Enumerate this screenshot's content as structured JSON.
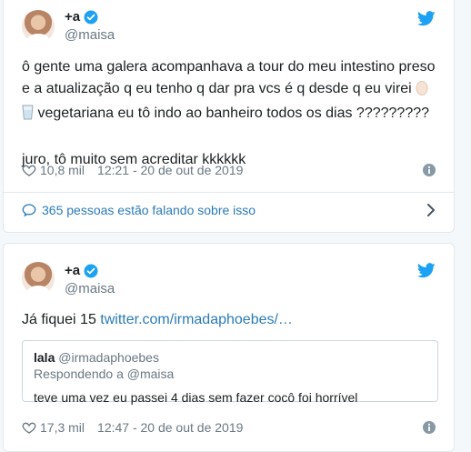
{
  "colors": {
    "accent": "#2b7bb9",
    "verified": "#1da1f2",
    "twitter": "#1da1f2",
    "muted": "#697882"
  },
  "tweets": [
    {
      "display_name": "+a",
      "handle": "@maisa",
      "text_line1": "ô gente uma galera acompanhava a tour do meu intestino preso e a atualização q eu tenho q dar pra vcs é q desde q eu virei",
      "text_line2": "vegetariana eu tô indo ao banheiro todos os dias ?????????",
      "text_para2": "juro, tô muito sem acreditar kkkkkk",
      "likes": "10,8 mil",
      "timestamp": "12:21 - 20 de out de 2019",
      "conversation": "365 pessoas estão falando sobre isso",
      "icons": [
        "avatar",
        "verified-icon",
        "twitter-bird-icon",
        "egg-icon",
        "glass-icon",
        "heart-icon",
        "info-icon",
        "comment-bubble-icon",
        "chevron-right-icon"
      ]
    },
    {
      "display_name": "+a",
      "handle": "@maisa",
      "text_prefix": "Já fiquei 15 ",
      "link": "twitter.com/irmadaphoebes/…",
      "quote": {
        "name": "lala",
        "handle": "@irmadaphoebes",
        "reply_label": "Respondendo a @maisa",
        "text": "teve uma vez eu passei 4 dias sem fazer cocô foi horrível"
      },
      "likes": "17,3 mil",
      "timestamp": "12:47 - 20 de out de 2019"
    }
  ]
}
